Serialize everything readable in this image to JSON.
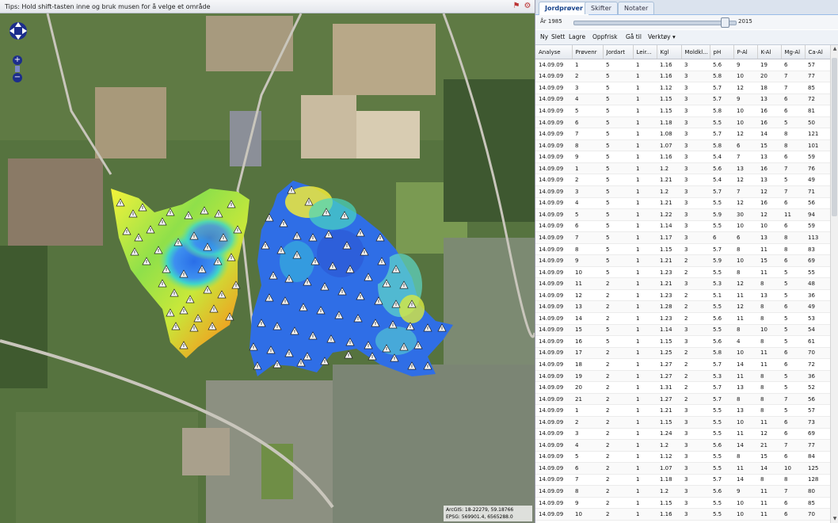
{
  "map": {
    "tip": "Tips: Hold shift-tasten inne og bruk musen for å velge et område",
    "coords_line1": "ArcGIS: 18-22279, 59.18766",
    "coords_line2": "EPSG: 569901.4, 6565288.0",
    "zoom_in": "+",
    "zoom_out": "−"
  },
  "tabs": [
    {
      "label": "Jordprøver",
      "active": true
    },
    {
      "label": "Skifter",
      "active": false
    },
    {
      "label": "Notater",
      "active": false
    }
  ],
  "year": {
    "start_label": "År 1985",
    "end_label": "2015",
    "value_fraction": 0.93
  },
  "toolbar": [
    "Ny",
    "Slett",
    "Lagre",
    "Oppfrisk",
    "Gå til",
    "Verktøy ▾"
  ],
  "table": {
    "columns": [
      "Analyse",
      "Prøvenr",
      "Jordart",
      "Leir...",
      "Kgl",
      "Moldkl...",
      "pH",
      "P-Al",
      "K-Al",
      "Mg-Al",
      "Ca-Al"
    ],
    "rows": [
      [
        "14.09.09",
        "1",
        "5",
        "1",
        "1.16",
        "3",
        "5.6",
        "9",
        "19",
        "6",
        "57"
      ],
      [
        "14.09.09",
        "2",
        "5",
        "1",
        "1.16",
        "3",
        "5.8",
        "10",
        "20",
        "7",
        "77"
      ],
      [
        "14.09.09",
        "3",
        "5",
        "1",
        "1.12",
        "3",
        "5.7",
        "12",
        "18",
        "7",
        "85"
      ],
      [
        "14.09.09",
        "4",
        "5",
        "1",
        "1.15",
        "3",
        "5.7",
        "9",
        "13",
        "6",
        "72"
      ],
      [
        "14.09.09",
        "5",
        "5",
        "1",
        "1.15",
        "3",
        "5.8",
        "10",
        "16",
        "6",
        "81"
      ],
      [
        "14.09.09",
        "6",
        "5",
        "1",
        "1.18",
        "3",
        "5.5",
        "10",
        "16",
        "5",
        "50"
      ],
      [
        "14.09.09",
        "7",
        "5",
        "1",
        "1.08",
        "3",
        "5.7",
        "12",
        "14",
        "8",
        "121"
      ],
      [
        "14.09.09",
        "8",
        "5",
        "1",
        "1.07",
        "3",
        "5.8",
        "6",
        "15",
        "8",
        "101"
      ],
      [
        "14.09.09",
        "9",
        "5",
        "1",
        "1.16",
        "3",
        "5.4",
        "7",
        "13",
        "6",
        "59"
      ],
      [
        "14.09.09",
        "1",
        "5",
        "1",
        "1.2",
        "3",
        "5.6",
        "13",
        "16",
        "7",
        "76"
      ],
      [
        "14.09.09",
        "2",
        "5",
        "1",
        "1.21",
        "3",
        "5.4",
        "12",
        "13",
        "5",
        "49"
      ],
      [
        "14.09.09",
        "3",
        "5",
        "1",
        "1.2",
        "3",
        "5.7",
        "7",
        "12",
        "7",
        "71"
      ],
      [
        "14.09.09",
        "4",
        "5",
        "1",
        "1.21",
        "3",
        "5.5",
        "12",
        "16",
        "6",
        "56"
      ],
      [
        "14.09.09",
        "5",
        "5",
        "1",
        "1.22",
        "3",
        "5.9",
        "30",
        "12",
        "11",
        "94"
      ],
      [
        "14.09.09",
        "6",
        "5",
        "1",
        "1.14",
        "3",
        "5.5",
        "10",
        "10",
        "6",
        "59"
      ],
      [
        "14.09.09",
        "7",
        "5",
        "1",
        "1.17",
        "3",
        "6",
        "6",
        "13",
        "8",
        "113"
      ],
      [
        "14.09.09",
        "8",
        "5",
        "1",
        "1.15",
        "3",
        "5.7",
        "8",
        "11",
        "8",
        "83"
      ],
      [
        "14.09.09",
        "9",
        "5",
        "1",
        "1.21",
        "2",
        "5.9",
        "10",
        "15",
        "6",
        "69"
      ],
      [
        "14.09.09",
        "10",
        "5",
        "1",
        "1.23",
        "2",
        "5.5",
        "8",
        "11",
        "5",
        "55"
      ],
      [
        "14.09.09",
        "11",
        "2",
        "1",
        "1.21",
        "3",
        "5.3",
        "12",
        "8",
        "5",
        "48"
      ],
      [
        "14.09.09",
        "12",
        "2",
        "1",
        "1.23",
        "2",
        "5.1",
        "11",
        "13",
        "5",
        "36"
      ],
      [
        "14.09.09",
        "13",
        "2",
        "1",
        "1.28",
        "2",
        "5.5",
        "12",
        "8",
        "6",
        "49"
      ],
      [
        "14.09.09",
        "14",
        "2",
        "1",
        "1.23",
        "2",
        "5.6",
        "11",
        "8",
        "5",
        "53"
      ],
      [
        "14.09.09",
        "15",
        "5",
        "1",
        "1.14",
        "3",
        "5.5",
        "8",
        "10",
        "5",
        "54"
      ],
      [
        "14.09.09",
        "16",
        "5",
        "1",
        "1.15",
        "3",
        "5.6",
        "4",
        "8",
        "5",
        "61"
      ],
      [
        "14.09.09",
        "17",
        "2",
        "1",
        "1.25",
        "2",
        "5.8",
        "10",
        "11",
        "6",
        "70"
      ],
      [
        "14.09.09",
        "18",
        "2",
        "1",
        "1.27",
        "2",
        "5.7",
        "14",
        "11",
        "6",
        "72"
      ],
      [
        "14.09.09",
        "19",
        "2",
        "1",
        "1.27",
        "2",
        "5.3",
        "11",
        "8",
        "5",
        "36"
      ],
      [
        "14.09.09",
        "20",
        "2",
        "1",
        "1.31",
        "2",
        "5.7",
        "13",
        "8",
        "5",
        "52"
      ],
      [
        "14.09.09",
        "21",
        "2",
        "1",
        "1.27",
        "2",
        "5.7",
        "8",
        "8",
        "7",
        "56"
      ],
      [
        "14.09.09",
        "1",
        "2",
        "1",
        "1.21",
        "3",
        "5.5",
        "13",
        "8",
        "5",
        "57"
      ],
      [
        "14.09.09",
        "2",
        "2",
        "1",
        "1.15",
        "3",
        "5.5",
        "10",
        "11",
        "6",
        "73"
      ],
      [
        "14.09.09",
        "3",
        "2",
        "1",
        "1.24",
        "3",
        "5.5",
        "11",
        "12",
        "6",
        "69"
      ],
      [
        "14.09.09",
        "4",
        "2",
        "1",
        "1.2",
        "3",
        "5.6",
        "14",
        "21",
        "7",
        "77"
      ],
      [
        "14.09.09",
        "5",
        "2",
        "1",
        "1.12",
        "3",
        "5.5",
        "8",
        "15",
        "6",
        "84"
      ],
      [
        "14.09.09",
        "6",
        "2",
        "1",
        "1.07",
        "3",
        "5.5",
        "11",
        "14",
        "10",
        "125"
      ],
      [
        "14.09.09",
        "7",
        "2",
        "1",
        "1.18",
        "3",
        "5.7",
        "14",
        "8",
        "8",
        "128"
      ],
      [
        "14.09.09",
        "8",
        "2",
        "1",
        "1.2",
        "3",
        "5.6",
        "9",
        "11",
        "7",
        "80"
      ],
      [
        "14.09.09",
        "9",
        "2",
        "1",
        "1.15",
        "3",
        "5.5",
        "10",
        "11",
        "6",
        "85"
      ],
      [
        "14.09.09",
        "10",
        "2",
        "1",
        "1.16",
        "3",
        "5.5",
        "10",
        "11",
        "6",
        "70"
      ]
    ]
  },
  "colors": {
    "tab_active_text": "#15428b",
    "nav_blue": "#1c2d8c"
  }
}
